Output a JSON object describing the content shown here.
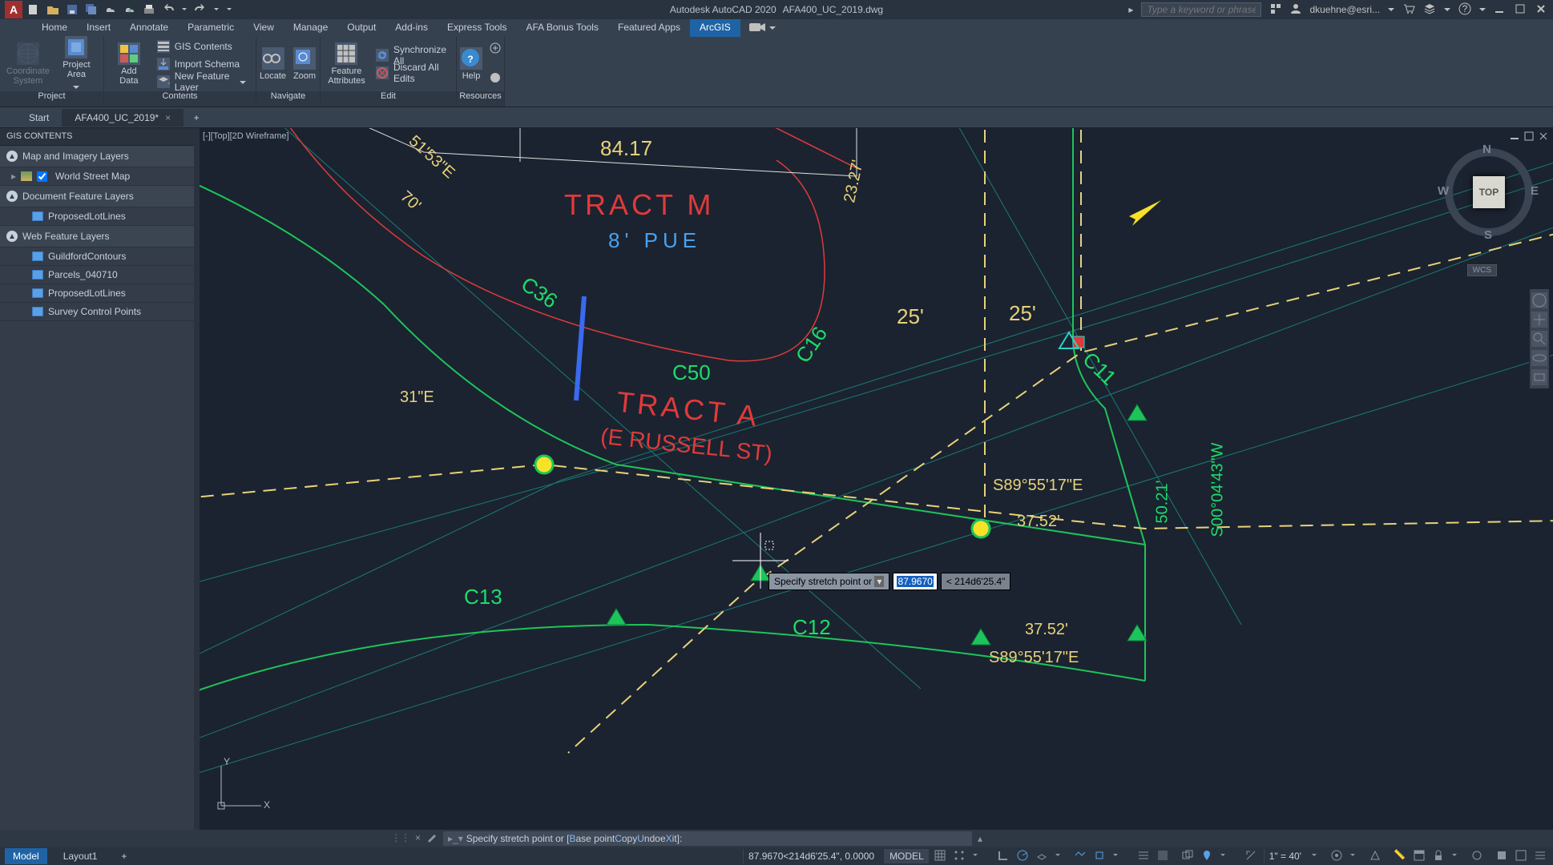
{
  "titlebar": {
    "app": "Autodesk AutoCAD 2020",
    "file": "AFA400_UC_2019.dwg",
    "search_placeholder": "Type a keyword or phrase",
    "user": "dkuehne@esri..."
  },
  "menu": {
    "tabs": [
      "Home",
      "Insert",
      "Annotate",
      "Parametric",
      "View",
      "Manage",
      "Output",
      "Add-ins",
      "Express Tools",
      "AFA Bonus Tools",
      "Featured Apps",
      "ArcGIS"
    ],
    "active": "ArcGIS"
  },
  "ribbon": {
    "project": {
      "coord": "Coordinate\nSystem",
      "area": "Project\nArea",
      "label": "Project"
    },
    "contents": {
      "add": "Add Data",
      "gis": "GIS Contents",
      "import": "Import Schema",
      "newfeat": "New Feature Layer",
      "label": "Contents"
    },
    "navigate": {
      "locate": "Locate",
      "zoom": "Zoom",
      "label": "Navigate"
    },
    "edit": {
      "attr": "Feature\nAttributes",
      "sync": "Synchronize All",
      "discard": "Discard All Edits",
      "label": "Edit"
    },
    "resources": {
      "help": "Help",
      "label": "Resources"
    }
  },
  "filetabs": {
    "start": "Start",
    "active": "AFA400_UC_2019*"
  },
  "sidebar": {
    "title": "GIS CONTENTS",
    "sect1": "Map and Imagery Layers",
    "wsm": "World Street Map",
    "sect2": "Document Feature Layers",
    "pll": "ProposedLotLines",
    "sect3": "Web Feature Layers",
    "w1": "GuildfordContours",
    "w2": "Parcels_040710",
    "w3": "ProposedLotLines",
    "w4": "Survey Control Points"
  },
  "canvas": {
    "viewlabel": "[-][Top][2D Wireframe]",
    "dim_top": "84.17",
    "tract_m": "TRACT  M",
    "pue": "8' PUE",
    "dim_2327": "23.27'",
    "c36": "C36",
    "c50": "C50",
    "c16": "C16",
    "c11": "C11",
    "c12": "C12",
    "c13": "C13",
    "d25a": "25'",
    "d25b": "25'",
    "tract_a1": "TRACT  A",
    "tract_a2": "(E RUSSELL ST)",
    "b_s895517e": "S89°55'17\"E",
    "b_3752": "37.52'",
    "b_s895517e2": "S89°55'17\"E",
    "b_37522": "37.52'",
    "b_5021": "50.21'",
    "b_s000443w": "S00°04'43\"W",
    "b_5153": "51'53\"E",
    "b_70": "70'",
    "b_31e": "31\"E",
    "prompt": "Specify stretch point or",
    "val": "87.9670",
    "ang": "< 214d6'25.4\"",
    "cube": {
      "top": "TOP",
      "n": "N",
      "e": "E",
      "s": "S",
      "w": "W"
    },
    "wcs": "WCS"
  },
  "cmd": {
    "text": "Specify stretch point or [",
    "opt_b": "B",
    "opt_base": "ase point ",
    "opt_c": "C",
    "opt_copy": "opy ",
    "opt_u": "U",
    "opt_undo": "ndo ",
    "opt_x": "X",
    "opt_exit": "it]:",
    "opt_e": "e"
  },
  "status": {
    "model": "Model",
    "layout": "Layout1",
    "coords": "87.9670<214d6'25.4\", 0.0000",
    "space": "MODEL",
    "scale": "1\" = 40'"
  }
}
